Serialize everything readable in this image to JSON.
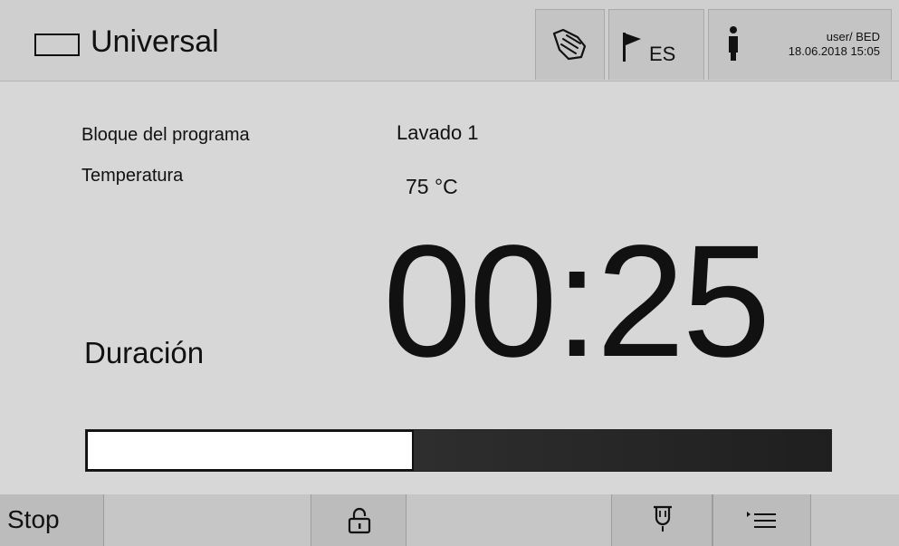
{
  "header": {
    "program_name": "Universal",
    "language_code": "ES",
    "user": "user/ BED",
    "datetime": "18.06.2018 15:05",
    "icons": [
      "program-rect-icon",
      "hand-icon",
      "flag-icon",
      "info-icon"
    ]
  },
  "content": {
    "program_block_label": "Bloque del programa",
    "program_block_value": "Lavado 1",
    "temperature_label": "Temperatura",
    "temperature_value": "75 °C",
    "duration_label": "Duración",
    "timer": "00:25"
  },
  "progress": {
    "fraction": 0.44
  },
  "footer": {
    "stop_label": "Stop",
    "icons": [
      "lock-icon",
      "spray-arm-icon",
      "menu-list-icon"
    ]
  }
}
